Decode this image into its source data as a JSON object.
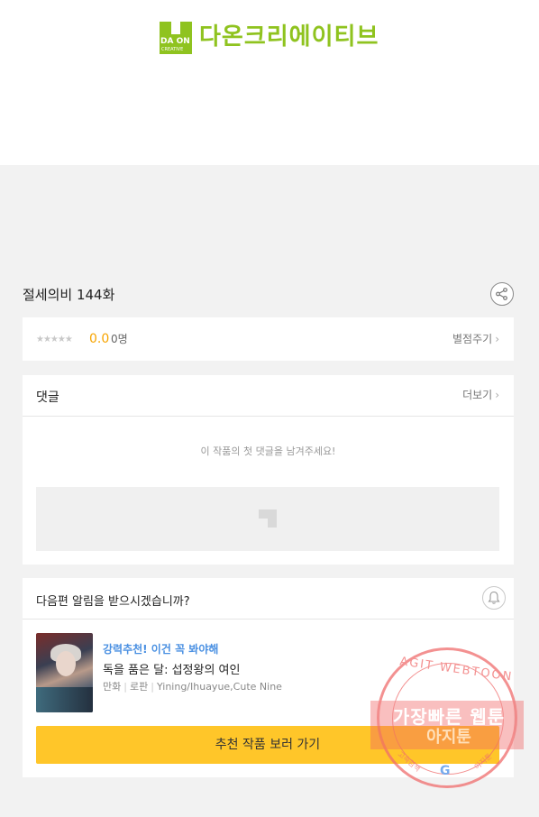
{
  "logo": {
    "mark_top": "DA ON",
    "mark_bottom": "CREATIVE",
    "name": "다온크리에이티브",
    "color": "#8fc31f"
  },
  "episode": {
    "title": "절세의비 144화",
    "share_icon": "share-icon"
  },
  "rating": {
    "stars": "★★★★★",
    "score": "0.0",
    "count": "0명",
    "rate_link": "별점주기"
  },
  "comments": {
    "title": "댓글",
    "more_link": "더보기",
    "empty_message": "이 작품의 첫 댓글을 남겨주세요!"
  },
  "notify": {
    "question": "다음편 알림을 받으시겠습니까?",
    "bell_icon": "bell-icon"
  },
  "recommend": {
    "tag": "강력추천! 이건 꼭 봐야해",
    "title": "독을 품은 달: 섭정왕의 여인",
    "genre1": "만화",
    "genre2": "로판",
    "authors": "Yining/Ihuayue,Cute Nine",
    "button_label": "추천 작품 보러 가기",
    "button_color": "#ffc629",
    "tag_color": "#4a90e2"
  },
  "watermark": {
    "arc_text": "AGIT WEBTOON",
    "line1": "가장빠른 웹툰",
    "line2": "아지툰",
    "g_mark": "G",
    "bottom_left": "고속검색",
    "bottom_right": "아지툰"
  }
}
